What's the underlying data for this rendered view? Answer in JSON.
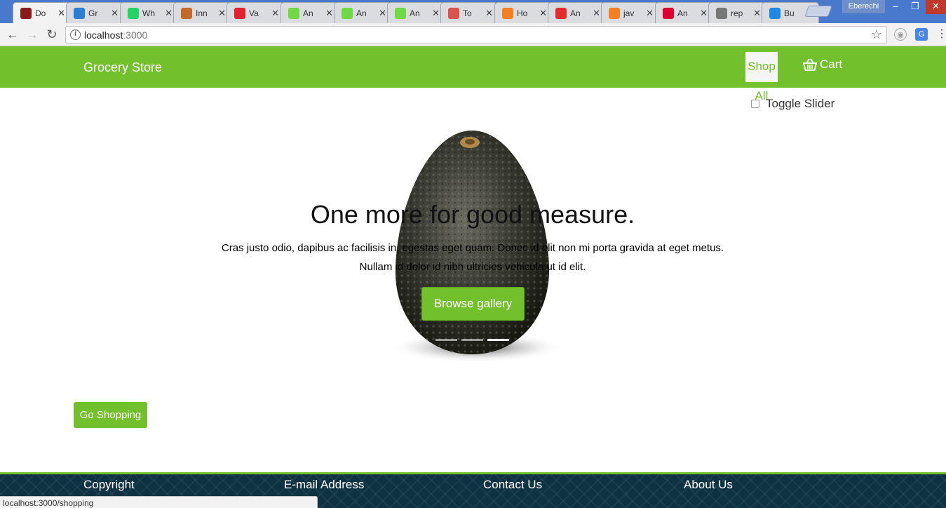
{
  "browser": {
    "tabs": [
      {
        "title": "Do",
        "icon": "spy-icon",
        "color": "#8b1a1a",
        "active": true
      },
      {
        "title": "Gr",
        "icon": "k-icon",
        "color": "#2a7fd4"
      },
      {
        "title": "Wh",
        "icon": "whatsapp-icon",
        "color": "#25d366"
      },
      {
        "title": "Inn",
        "icon": "image-icon",
        "color": "#c26a2a"
      },
      {
        "title": "Va",
        "icon": "opera-icon",
        "color": "#e0222f"
      },
      {
        "title": "An",
        "icon": "upwork-icon",
        "color": "#6fda44"
      },
      {
        "title": "An",
        "icon": "upwork-icon",
        "color": "#6fda44"
      },
      {
        "title": "An",
        "icon": "upwork-icon",
        "color": "#6fda44"
      },
      {
        "title": "To",
        "icon": "xe-icon",
        "color": "#d9534f"
      },
      {
        "title": "Ho",
        "icon": "stackoverflow-icon",
        "color": "#f48024"
      },
      {
        "title": "An",
        "icon": "as-icon",
        "color": "#e32d2d"
      },
      {
        "title": "jav",
        "icon": "stackoverflow-icon",
        "color": "#f48024"
      },
      {
        "title": "An",
        "icon": "angular-icon",
        "color": "#dd0031"
      },
      {
        "title": "rep",
        "icon": "spiral-icon",
        "color": "#777777"
      },
      {
        "title": "Bu",
        "icon": "refresh-blue-icon",
        "color": "#1e88e5"
      }
    ],
    "user_name": "Eberechi",
    "url_host": "localhost",
    "url_port": ":3000",
    "status_url": "localhost:3000/shopping"
  },
  "header": {
    "brand": "Grocery Store",
    "shop_all": "Shop All",
    "cart": "Cart"
  },
  "toggle": {
    "label": "Toggle Slider",
    "checked": false
  },
  "slider": {
    "title": "One more for good measure.",
    "text": "Cras justo odio, dapibus ac facilisis in, egestas eget quam. Donec id elit non mi porta gravida at eget metus. Nullam id dolor id nibh ultricies vehicula ut id elit.",
    "button": "Browse gallery",
    "slide_count": 3,
    "active_slide": 3
  },
  "main": {
    "go_shopping": "Go Shopping"
  },
  "footer": {
    "items": [
      "Copyright",
      "E-mail Address",
      "Contact Us",
      "About Us"
    ]
  },
  "colors": {
    "brand_green": "#72c02c",
    "footer_navy": "#0f3242"
  }
}
